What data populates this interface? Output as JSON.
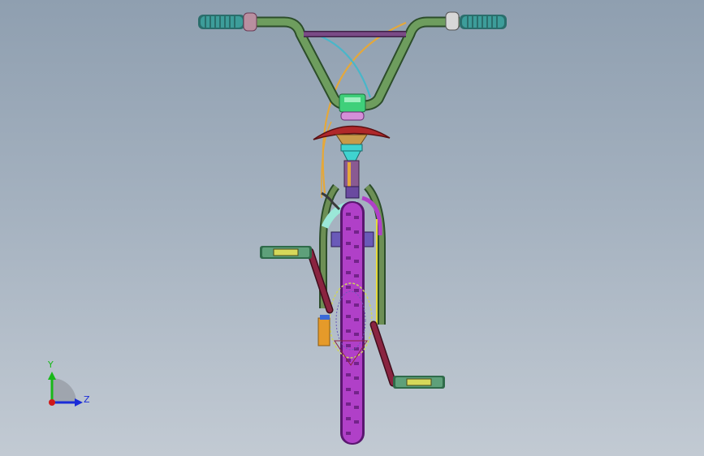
{
  "viewport": {
    "background_top": "#8f9fb0",
    "background_bottom": "#c2cad3"
  },
  "model": {
    "description_icon": "bmx-bike-front-view",
    "colors": {
      "handlebar": "#5f8f52",
      "handlebar_outline": "#2c4d2a",
      "crossbar": "#7a4a86",
      "grips": "#3d9d9a",
      "cable_orange": "#e5a83a",
      "cable_cyan": "#49b6c9",
      "fender": "#b0282a",
      "stem": "#3fd07a",
      "headset": "#3fd3d0",
      "fork": "#6d8f55",
      "tire": "#b040c8",
      "tire_dark": "#5a1770",
      "crank": "#8a2440",
      "pedal": "#5ea07a",
      "pedal_body": "#2f6b4a",
      "sprocket": "#cfd65a",
      "orange_part": "#e59a2a"
    }
  },
  "triad": {
    "y_label": "Y",
    "z_label": "Z",
    "y_color": "#18b818",
    "z_color": "#1a2bd8",
    "origin_color": "#d01818"
  }
}
